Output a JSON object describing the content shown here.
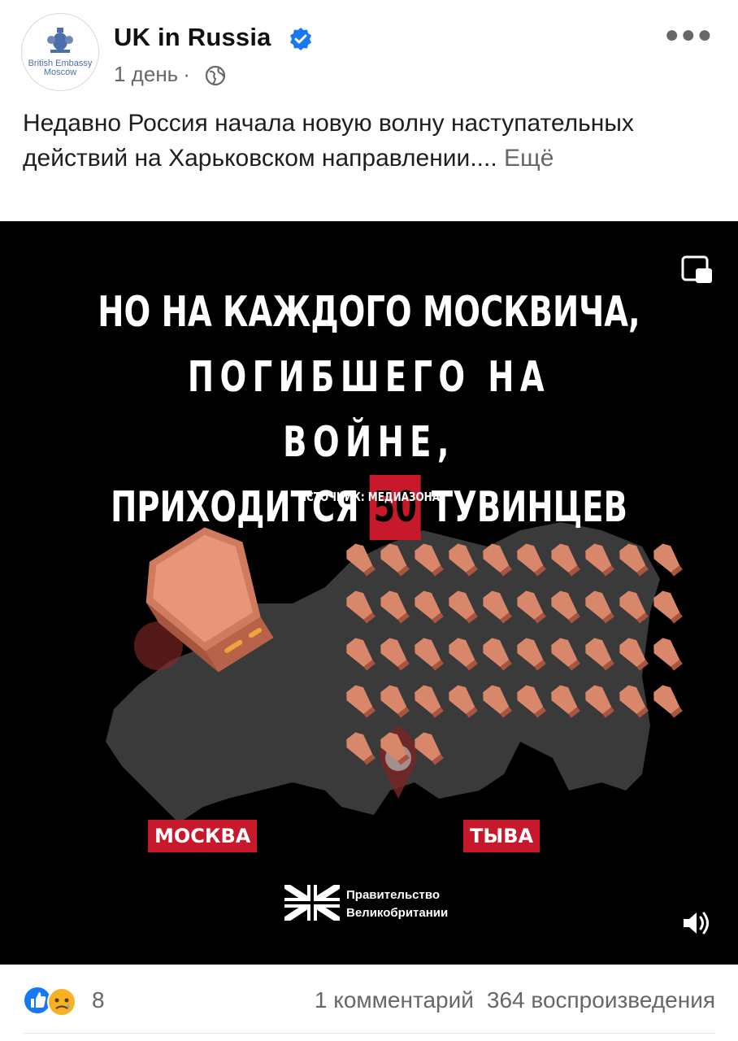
{
  "post": {
    "page_name": "UK in Russia",
    "avatar_text_line1": "British Embassy",
    "avatar_text_line2": "Moscow",
    "time": "1 день",
    "time_separator": "·",
    "text": "Недавно Россия начала новую волну наступательных действий на Харьковском направлении....",
    "see_more": "Ещё"
  },
  "video": {
    "headline_line1": "НО НА КАЖДОГО МОСКВИЧА,",
    "headline_line2": "ПОГИБШЕГО НА ВОЙНЕ,",
    "headline_line3_pre": "ПРИХОДИТСЯ",
    "headline_number": "50",
    "headline_line3_post": "ТУВИНЦЕВ",
    "source": "ИСТОЧНИК: МЕДИАЗОНА",
    "label_moscow": "МОСКВА",
    "label_tyva": "ТЫВА",
    "gov_line1": "Правительство",
    "gov_line2": "Великобритании",
    "coffin_count_small": 43,
    "accent_color": "#c8192c"
  },
  "footer": {
    "reaction_count": "8",
    "comments": "1 комментарий",
    "views": "364 воспроизведения"
  },
  "icons": [
    "crest-icon",
    "verified-badge-icon",
    "globe-icon",
    "more-options-icon",
    "pip-icon",
    "volume-icon",
    "like-reaction-icon",
    "sad-reaction-icon",
    "union-jack-icon"
  ]
}
